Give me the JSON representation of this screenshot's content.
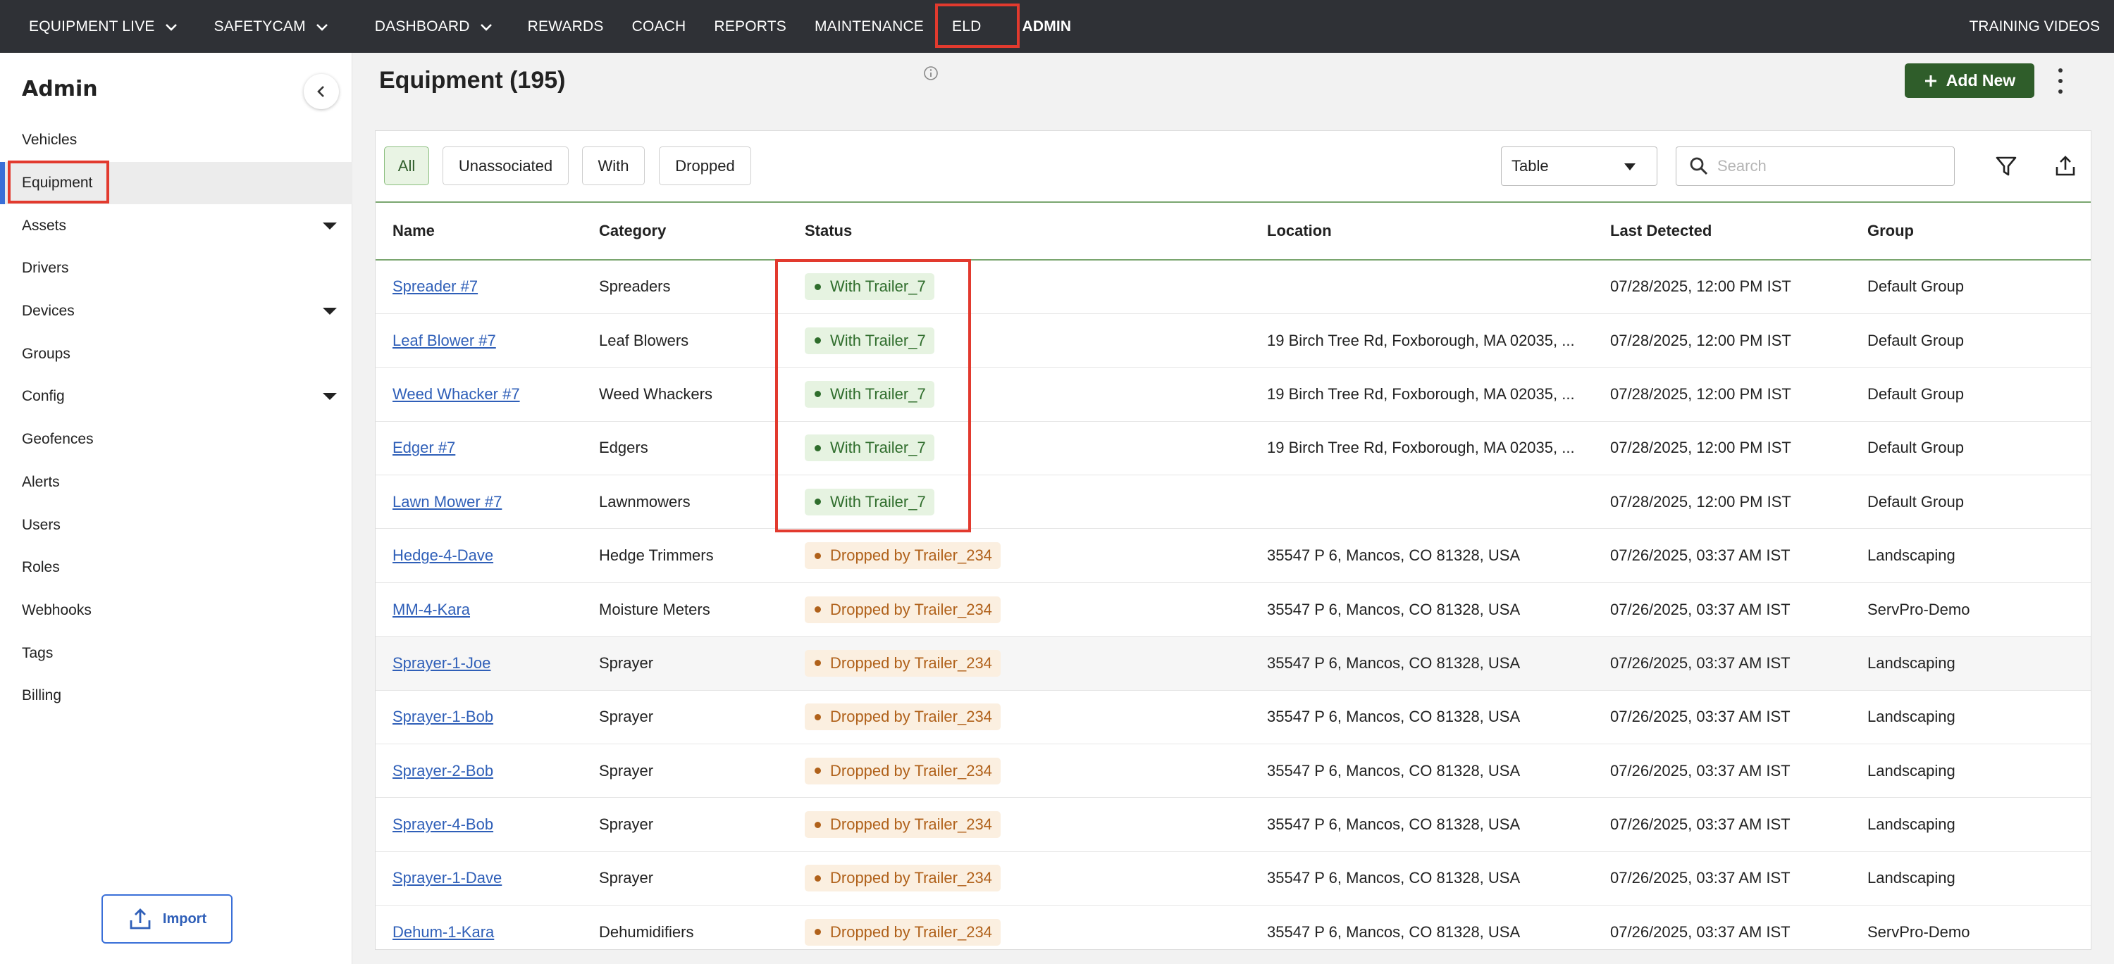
{
  "topnav": {
    "items": [
      {
        "label": "EQUIPMENT LIVE",
        "dropdown": true
      },
      {
        "label": "SAFETYCAM",
        "dropdown": true
      },
      {
        "label": "DASHBOARD",
        "dropdown": true
      },
      {
        "label": "REWARDS"
      },
      {
        "label": "COACH"
      },
      {
        "label": "REPORTS"
      },
      {
        "label": "MAINTENANCE"
      },
      {
        "label": "ELD"
      },
      {
        "label": "ADMIN",
        "active": true
      }
    ],
    "right_link": "TRAINING VIDEOS"
  },
  "sidebar": {
    "title": "Admin",
    "items": [
      {
        "label": "Vehicles"
      },
      {
        "label": "Equipment",
        "active": true
      },
      {
        "label": "Assets",
        "expandable": true
      },
      {
        "label": "Drivers"
      },
      {
        "label": "Devices",
        "expandable": true
      },
      {
        "label": "Groups"
      },
      {
        "label": "Config",
        "expandable": true
      },
      {
        "label": "Geofences"
      },
      {
        "label": "Alerts"
      },
      {
        "label": "Users"
      },
      {
        "label": "Roles"
      },
      {
        "label": "Webhooks"
      },
      {
        "label": "Tags"
      },
      {
        "label": "Billing"
      }
    ],
    "import_label": "Import"
  },
  "header": {
    "title": "Equipment (195)",
    "add_new_label": "Add New"
  },
  "filters": {
    "chips": [
      "All",
      "Unassociated",
      "With",
      "Dropped"
    ],
    "active": "All",
    "view_select": "Table",
    "search_placeholder": "Search"
  },
  "table": {
    "columns": [
      "Name",
      "Category",
      "Status",
      "Location",
      "Last Detected",
      "Group"
    ],
    "rows": [
      {
        "name": "Spreader #7",
        "category": "Spreaders",
        "status": "With Trailer_7",
        "status_type": "with",
        "location": "",
        "last_detected": "07/28/2025, 12:00 PM IST",
        "group": "Default Group"
      },
      {
        "name": "Leaf Blower #7",
        "category": "Leaf Blowers",
        "status": "With Trailer_7",
        "status_type": "with",
        "location": "19 Birch Tree Rd, Foxborough, MA 02035, ...",
        "last_detected": "07/28/2025, 12:00 PM IST",
        "group": "Default Group"
      },
      {
        "name": "Weed Whacker #7",
        "category": "Weed Whackers",
        "status": "With Trailer_7",
        "status_type": "with",
        "location": "19 Birch Tree Rd, Foxborough, MA 02035, ...",
        "last_detected": "07/28/2025, 12:00 PM IST",
        "group": "Default Group"
      },
      {
        "name": "Edger #7",
        "category": "Edgers",
        "status": "With Trailer_7",
        "status_type": "with",
        "location": "19 Birch Tree Rd, Foxborough, MA 02035, ...",
        "last_detected": "07/28/2025, 12:00 PM IST",
        "group": "Default Group"
      },
      {
        "name": "Lawn Mower #7",
        "category": "Lawnmowers",
        "status": "With Trailer_7",
        "status_type": "with",
        "location": "",
        "last_detected": "07/28/2025, 12:00 PM IST",
        "group": "Default Group"
      },
      {
        "name": "Hedge-4-Dave",
        "category": "Hedge Trimmers",
        "status": "Dropped by Trailer_234",
        "status_type": "dropped",
        "location": "35547 P 6, Mancos, CO 81328, USA",
        "last_detected": "07/26/2025, 03:37 AM IST",
        "group": "Landscaping"
      },
      {
        "name": "MM-4-Kara",
        "category": "Moisture Meters",
        "status": "Dropped by Trailer_234",
        "status_type": "dropped",
        "location": "35547 P 6, Mancos, CO 81328, USA",
        "last_detected": "07/26/2025, 03:37 AM IST",
        "group": "ServPro-Demo"
      },
      {
        "name": "Sprayer-1-Joe",
        "category": "Sprayer",
        "status": "Dropped by Trailer_234",
        "status_type": "dropped",
        "location": "35547 P 6, Mancos, CO 81328, USA",
        "last_detected": "07/26/2025, 03:37 AM IST",
        "group": "Landscaping",
        "shaded": true
      },
      {
        "name": "Sprayer-1-Bob",
        "category": "Sprayer",
        "status": "Dropped by Trailer_234",
        "status_type": "dropped",
        "location": "35547 P 6, Mancos, CO 81328, USA",
        "last_detected": "07/26/2025, 03:37 AM IST",
        "group": "Landscaping"
      },
      {
        "name": "Sprayer-2-Bob",
        "category": "Sprayer",
        "status": "Dropped by Trailer_234",
        "status_type": "dropped",
        "location": "35547 P 6, Mancos, CO 81328, USA",
        "last_detected": "07/26/2025, 03:37 AM IST",
        "group": "Landscaping"
      },
      {
        "name": "Sprayer-4-Bob",
        "category": "Sprayer",
        "status": "Dropped by Trailer_234",
        "status_type": "dropped",
        "location": "35547 P 6, Mancos, CO 81328, USA",
        "last_detected": "07/26/2025, 03:37 AM IST",
        "group": "Landscaping"
      },
      {
        "name": "Sprayer-1-Dave",
        "category": "Sprayer",
        "status": "Dropped by Trailer_234",
        "status_type": "dropped",
        "location": "35547 P 6, Mancos, CO 81328, USA",
        "last_detected": "07/26/2025, 03:37 AM IST",
        "group": "Landscaping"
      },
      {
        "name": "Dehum-1-Kara",
        "category": "Dehumidifiers",
        "status": "Dropped by Trailer_234",
        "status_type": "dropped",
        "location": "35547 P 6, Mancos, CO 81328, USA",
        "last_detected": "07/26/2025, 03:37 AM IST",
        "group": "ServPro-Demo"
      }
    ]
  },
  "colors": {
    "nav_bg": "#2f3136",
    "accent_green": "#2f5d2a",
    "link_blue": "#2f5fb8",
    "highlight_red": "#e23a2e",
    "with_badge_bg": "#e6f3e1",
    "dropped_badge_bg": "#fbefe0"
  }
}
